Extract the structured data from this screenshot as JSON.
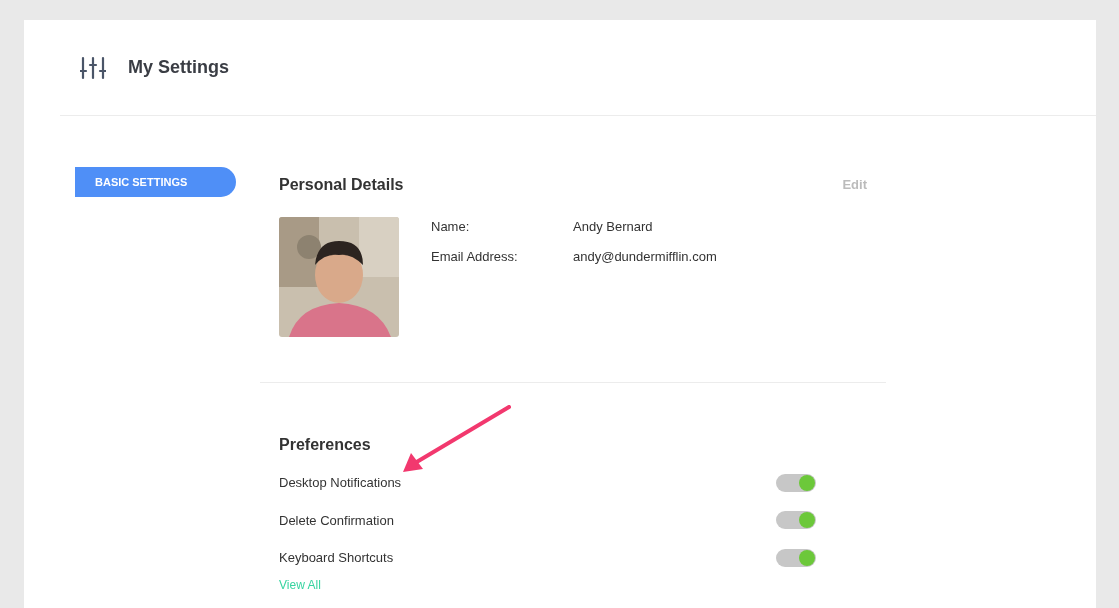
{
  "header": {
    "title": "My Settings"
  },
  "sidebar": {
    "items": [
      {
        "label": "BASIC SETTINGS",
        "selected": true
      }
    ]
  },
  "personal_details": {
    "title": "Personal Details",
    "edit": "Edit",
    "fields": [
      {
        "label": "Name:",
        "value": "Andy Bernard"
      },
      {
        "label": "Email Address:",
        "value": "andy@dundermifflin.com"
      }
    ]
  },
  "preferences": {
    "title": "Preferences",
    "items": [
      {
        "label": "Desktop Notifications",
        "on": true
      },
      {
        "label": "Delete Confirmation",
        "on": true
      },
      {
        "label": "Keyboard Shortcuts",
        "on": true
      }
    ],
    "link": "View All"
  }
}
